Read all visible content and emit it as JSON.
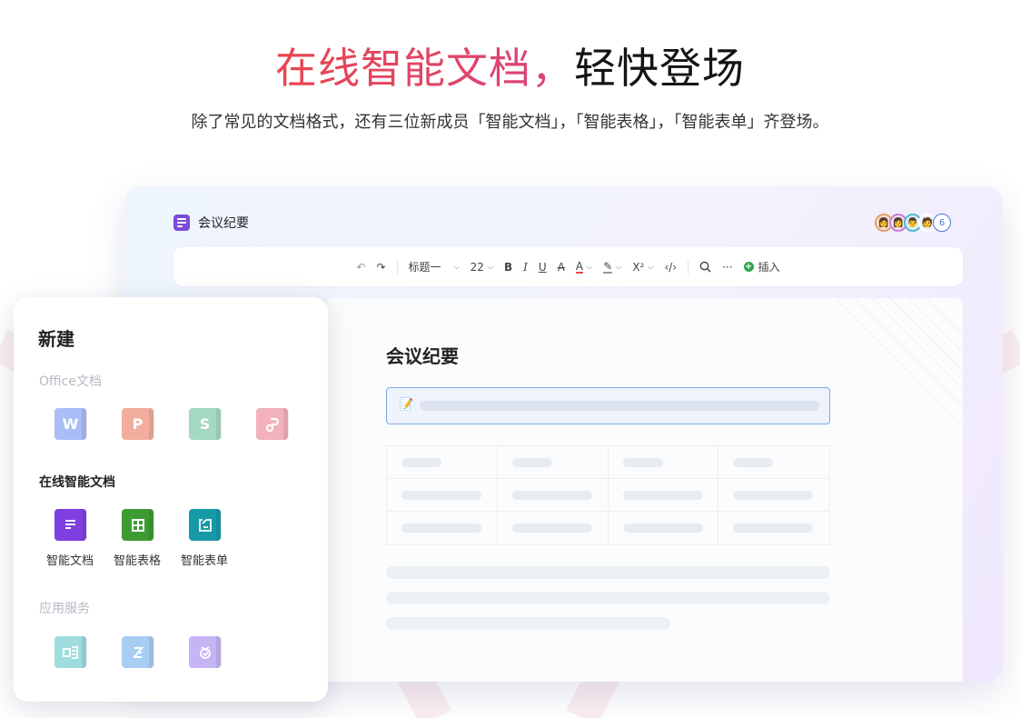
{
  "hero": {
    "title_highlight": "在线智能文档，",
    "title_rest": "轻快登场",
    "subtitle": "除了常见的文档格式，还有三位新成员「智能文档」，「智能表格」，「智能表单」齐登场。"
  },
  "editor": {
    "doc_title": "会议纪要",
    "collaborator_count": "6",
    "toolbar": {
      "heading": "标题一",
      "font_size": "22",
      "bold": "B",
      "italic": "I",
      "underline": "U",
      "strike": "A",
      "color": "A",
      "superscript": "X²",
      "more": "···",
      "insert": "插入"
    },
    "page_title": "会议纪要"
  },
  "new_panel": {
    "title": "新建",
    "office_section": "Office文档",
    "office_items": [
      {
        "glyph": "W",
        "icon": "word-icon"
      },
      {
        "glyph": "P",
        "icon": "ppt-icon"
      },
      {
        "glyph": "S",
        "icon": "sheet-icon"
      },
      {
        "glyph": "",
        "icon": "pdf-icon"
      }
    ],
    "smart_section": "在线智能文档",
    "smart_items": [
      {
        "label": "智能文档",
        "icon": "smart-doc-icon"
      },
      {
        "label": "智能表格",
        "icon": "smart-sheet-icon"
      },
      {
        "label": "智能表单",
        "icon": "smart-form-icon"
      }
    ],
    "app_section": "应用服务",
    "app_items": [
      {
        "icon": "app-service-1-icon"
      },
      {
        "icon": "app-service-2-icon"
      },
      {
        "icon": "app-service-3-icon"
      }
    ]
  },
  "colors": {
    "accent_red": "#e8454f",
    "smart_doc": "#7f3fe0",
    "smart_sheet": "#3d9b33",
    "smart_form": "#179aa8"
  }
}
